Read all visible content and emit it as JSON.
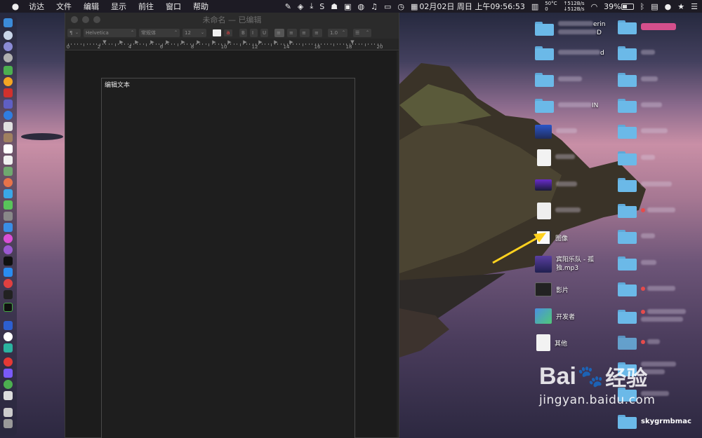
{
  "menubar": {
    "apple": "",
    "items": [
      "访达",
      "文件",
      "编辑",
      "显示",
      "前往",
      "窗口",
      "帮助"
    ],
    "net_up": "↑512B/s",
    "net_down": "↓512B/s",
    "temp": "50°C",
    "temp2": "0",
    "date": "02月02日 周日 上午09:56:53",
    "battery": "39%",
    "s_icon": "S"
  },
  "window": {
    "title": "未命名 — 已编辑",
    "toolbar": {
      "paragraph": "¶",
      "font": "Helvetica",
      "style": "常规体",
      "size": "12",
      "bold": "B",
      "italic": "I",
      "underline": "U",
      "spacing": "1.0"
    },
    "ruler_numbers": [
      "0",
      "2",
      "4",
      "6",
      "8",
      "10",
      "12",
      "14",
      "16",
      "18",
      "20"
    ],
    "content": "编辑文本"
  },
  "desktop": {
    "col1": [
      {
        "label": "erin",
        "label2": "D",
        "type": "folder"
      },
      {
        "label": "d",
        "type": "folder"
      },
      {
        "label": "",
        "type": "folder"
      },
      {
        "label": "IN",
        "type": "folder"
      },
      {
        "label": "",
        "type": "movie"
      },
      {
        "label": "",
        "type": "doc"
      },
      {
        "label": "",
        "type": "image2"
      },
      {
        "label": "",
        "type": "pdf"
      },
      {
        "label": "图像",
        "type": "images"
      },
      {
        "label": "宾阳乐队 - 孤独.mp3",
        "type": "mp3"
      },
      {
        "label": "影片",
        "type": "movies"
      },
      {
        "label": "开发者",
        "type": "dev"
      },
      {
        "label": "其他",
        "type": "other"
      }
    ],
    "col2_count": 16,
    "col2_labels": [
      "",
      "",
      "",
      "",
      "",
      "",
      "",
      "",
      "",
      "",
      "",
      "",
      "",
      "",
      "",
      ""
    ]
  },
  "watermark": {
    "brand": "Bai",
    "brand2": "经验",
    "url": "jingyan.baidu.com",
    "user": "skygrmbmac"
  },
  "colors": {
    "accent": "#ffd21f",
    "folder": "#6bb9e8"
  }
}
